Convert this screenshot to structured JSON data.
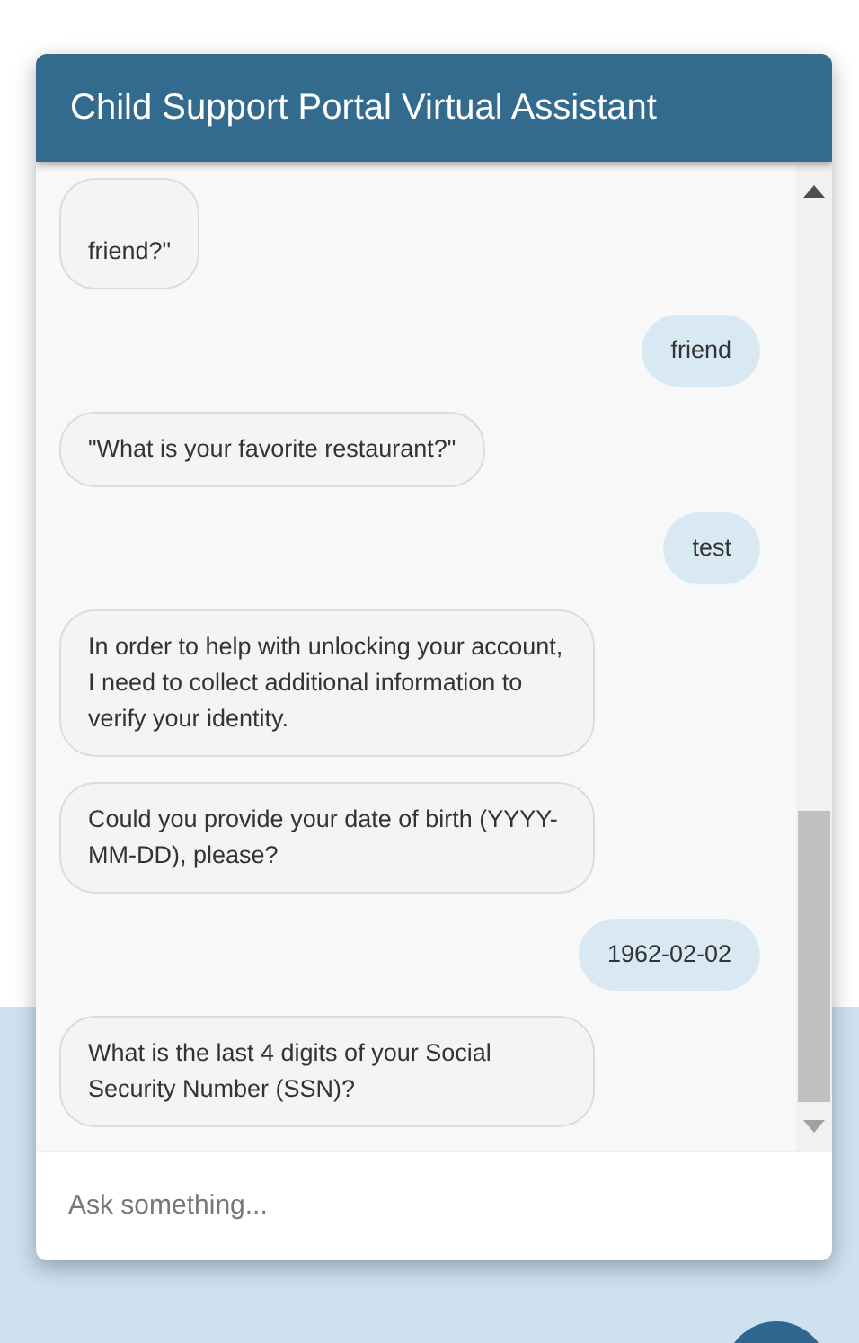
{
  "header": {
    "title": "Child Support Portal Virtual Assistant"
  },
  "messages": [
    {
      "kind": "bot",
      "text": "friend?\"",
      "cut": true
    },
    {
      "kind": "user",
      "text": "friend"
    },
    {
      "kind": "bot",
      "text": "\"What is your favorite restaurant?\""
    },
    {
      "kind": "user",
      "text": "test"
    },
    {
      "kind": "bot",
      "text": "In order to help with unlocking your account, I need to collect additional information to verify your identity."
    },
    {
      "kind": "bot",
      "text": "Could you provide your date of birth (YYYY-MM-DD), please?"
    },
    {
      "kind": "user",
      "text": "1962-02-02"
    },
    {
      "kind": "bot",
      "text": "What is the last 4 digits of your Social Security Number (SSN)?"
    }
  ],
  "input": {
    "placeholder": "Ask something..."
  }
}
